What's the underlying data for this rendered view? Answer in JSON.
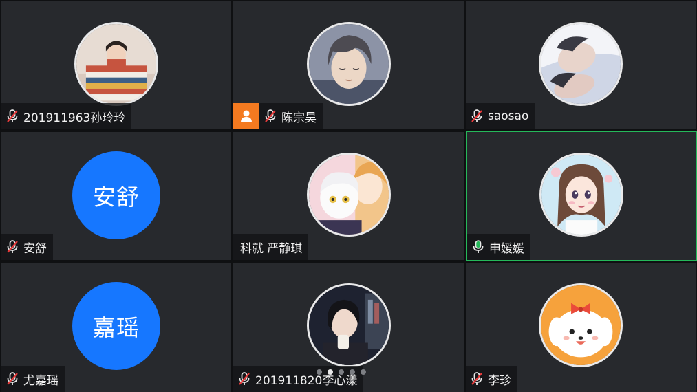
{
  "meeting": {
    "participants": [
      {
        "name": "201911963孙玲玲",
        "mic": "muted",
        "avatar": "photo-striped-sweater"
      },
      {
        "name": "陈宗昊",
        "mic": "muted",
        "avatar": "anime-boy",
        "host": true
      },
      {
        "name": "saosao",
        "mic": "muted",
        "avatar": "photo-sleeping"
      },
      {
        "name": "安舒",
        "mic": "muted",
        "avatar_initials": "安舒",
        "avatar_color": "#1677ff"
      },
      {
        "name": "科就 严静琪",
        "mic": "none",
        "avatar": "anime-duo"
      },
      {
        "name": "申媛媛",
        "mic": "active",
        "avatar": "cartoon-girl",
        "speaking": true
      },
      {
        "name": "尤嘉瑶",
        "mic": "muted",
        "avatar_initials": "嘉瑶",
        "avatar_color": "#1677ff"
      },
      {
        "name": "201911820李心漾",
        "mic": "muted",
        "avatar": "photo-girl-cup"
      },
      {
        "name": "李珍",
        "mic": "muted",
        "avatar": "cartoon-puppy"
      }
    ],
    "page_indicator": {
      "total": 5,
      "current": 2
    },
    "colors": {
      "tile_bg": "#27292d",
      "speaking_border": "#25b85a",
      "mic_active": "#25b85a",
      "host_badge": "#f47a20",
      "initials_bg": "#1677ff"
    }
  }
}
